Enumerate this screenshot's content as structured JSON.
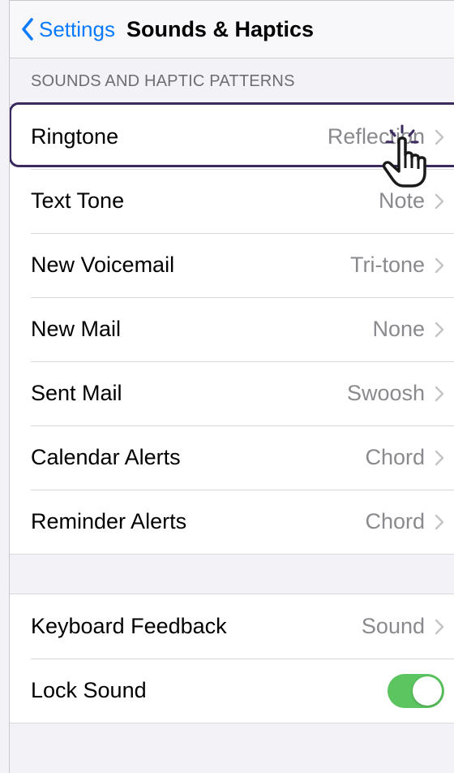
{
  "nav": {
    "back_label": "Settings",
    "title": "Sounds & Haptics"
  },
  "section": {
    "header": "SOUNDS AND HAPTIC PATTERNS",
    "rows": [
      {
        "label": "Ringtone",
        "value": "Reflection"
      },
      {
        "label": "Text Tone",
        "value": "Note"
      },
      {
        "label": "New Voicemail",
        "value": "Tri-tone"
      },
      {
        "label": "New Mail",
        "value": "None"
      },
      {
        "label": "Sent Mail",
        "value": "Swoosh"
      },
      {
        "label": "Calendar Alerts",
        "value": "Chord"
      },
      {
        "label": "Reminder Alerts",
        "value": "Chord"
      }
    ]
  },
  "section2": {
    "rows": [
      {
        "label": "Keyboard Feedback",
        "value": "Sound"
      },
      {
        "label": "Lock Sound",
        "toggle_on": true
      }
    ]
  },
  "colors": {
    "accent": "#0a7aff",
    "highlight": "#3b2a5e",
    "toggle_on": "#5cc55f"
  },
  "icons": [
    "chevron-left-icon",
    "chevron-right-icon",
    "pointer-hand-icon"
  ]
}
